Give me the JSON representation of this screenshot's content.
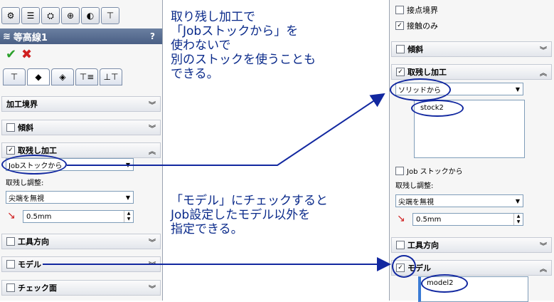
{
  "left_panel": {
    "title": "等高線1",
    "help": "?",
    "ok": "✔",
    "cancel": "✖",
    "sections": {
      "boundary": "加工境界",
      "slope": "傾斜",
      "rest": "取残し加工",
      "tool_dir": "工具方向",
      "model": "モデル",
      "check_face": "チェック面"
    },
    "rest_select": "Jobストックから",
    "rest_adjust_label": "取残し調整:",
    "edge_select": "尖端を無視",
    "value": "0.5mm"
  },
  "right_panel": {
    "contact_boundary": "接点境界",
    "contact_only": "接触のみ",
    "sections": {
      "slope": "傾斜",
      "rest": "取残し加工",
      "tool_dir": "工具方向",
      "model": "モデル"
    },
    "rest_select": "ソリッドから",
    "stock_item": "stock2",
    "job_stock_check": "Job ストックから",
    "rest_adjust_label": "取残し調整:",
    "edge_select": "尖端を無視",
    "value": "0.5mm",
    "model_item": "model2"
  },
  "notes": {
    "top": [
      "取り残し加工で",
      "「Jobストックから」を",
      "使わないで",
      "別のストックを使うことも",
      "できる。"
    ],
    "bottom": [
      "「モデル」にチェックすると",
      "Job設定したモデル以外を",
      "指定できる。"
    ]
  },
  "colors": {
    "annotation": "#0a2a8a",
    "accent": "#4a5f85"
  }
}
